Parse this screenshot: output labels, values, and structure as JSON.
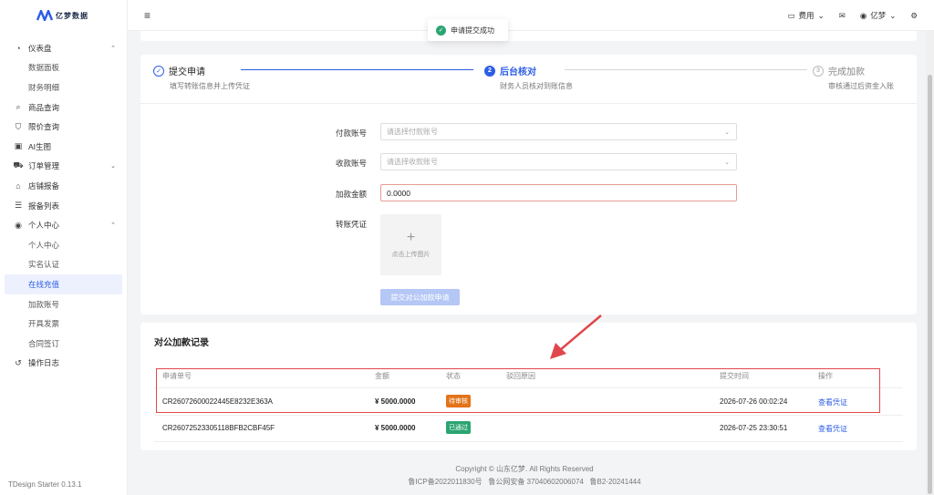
{
  "app": {
    "logo_text": "亿梦数据",
    "version": "TDesign Starter 0.13.1"
  },
  "sidebar": {
    "items": [
      {
        "label": "仪表盘",
        "icon": "dashboard-icon",
        "expand": "up"
      },
      {
        "label": "数据面板",
        "sub": true
      },
      {
        "label": "财务明细",
        "sub": true
      },
      {
        "label": "商品查询",
        "icon": "search-icon"
      },
      {
        "label": "限价查询",
        "icon": "filter-icon"
      },
      {
        "label": "AI生图",
        "icon": "image-icon"
      },
      {
        "label": "订单管理",
        "icon": "cart-icon",
        "expand": "down"
      },
      {
        "label": "店铺报备",
        "icon": "shop-icon"
      },
      {
        "label": "报备列表",
        "icon": "list-icon"
      },
      {
        "label": "个人中心",
        "icon": "user-circle-icon",
        "expand": "up"
      },
      {
        "label": "个人中心",
        "sub": true
      },
      {
        "label": "实名认证",
        "sub": true
      },
      {
        "label": "在线充值",
        "sub": true,
        "active": true
      },
      {
        "label": "加款账号",
        "sub": true
      },
      {
        "label": "开具发票",
        "sub": true
      },
      {
        "label": "合同签订",
        "sub": true
      },
      {
        "label": "操作日志",
        "icon": "history-icon"
      }
    ]
  },
  "header": {
    "fee_label": "费用",
    "user_label": "亿梦"
  },
  "toast": {
    "text": "申请提交成功"
  },
  "steps": [
    {
      "title": "提交申请",
      "desc": "填写转账信息并上传凭证",
      "status": "done"
    },
    {
      "title": "后台核对",
      "desc": "财务人员核对到账信息",
      "status": "active",
      "num": "2"
    },
    {
      "title": "完成加款",
      "desc": "审核通过后资金入账",
      "status": "wait",
      "num": "3"
    }
  ],
  "form": {
    "pay_account_label": "付款账号",
    "pay_account_placeholder": "请选择付款账号",
    "recv_account_label": "收款账号",
    "recv_account_placeholder": "请选择收款账号",
    "amount_label": "加款金额",
    "amount_value": "0.0000",
    "voucher_label": "转账凭证",
    "upload_text": "点击上传图片",
    "submit_label": "提交对公加款申请"
  },
  "records": {
    "title": "对公加款记录",
    "columns": [
      "申请单号",
      "金额",
      "状态",
      "驳回原因",
      "提交时间",
      "操作"
    ],
    "rows": [
      {
        "id": "CR26072600022445E8232E363A",
        "amount": "¥ 5000.0000",
        "status": "待审核",
        "status_type": "pending",
        "reason": "",
        "time": "2026-07-26 00:02:24",
        "action": "查看凭证"
      },
      {
        "id": "CR26072523305118BFB2CBF45F",
        "amount": "¥ 5000.0000",
        "status": "已通过",
        "status_type": "pass",
        "reason": "",
        "time": "2026-07-25 23:30:51",
        "action": "查看凭证"
      }
    ]
  },
  "footer": {
    "copyright": "Copyright © 山东亿梦. All Rights Reserved",
    "icp": "鲁ICP备2022011830号",
    "police": "鲁公网安备 37040602006074",
    "b2": "鲁B2-20241444"
  },
  "colors": {
    "primary": "#2c5de5",
    "pending": "#e37318",
    "pass": "#2ba471",
    "highlight": "#e0474c"
  }
}
